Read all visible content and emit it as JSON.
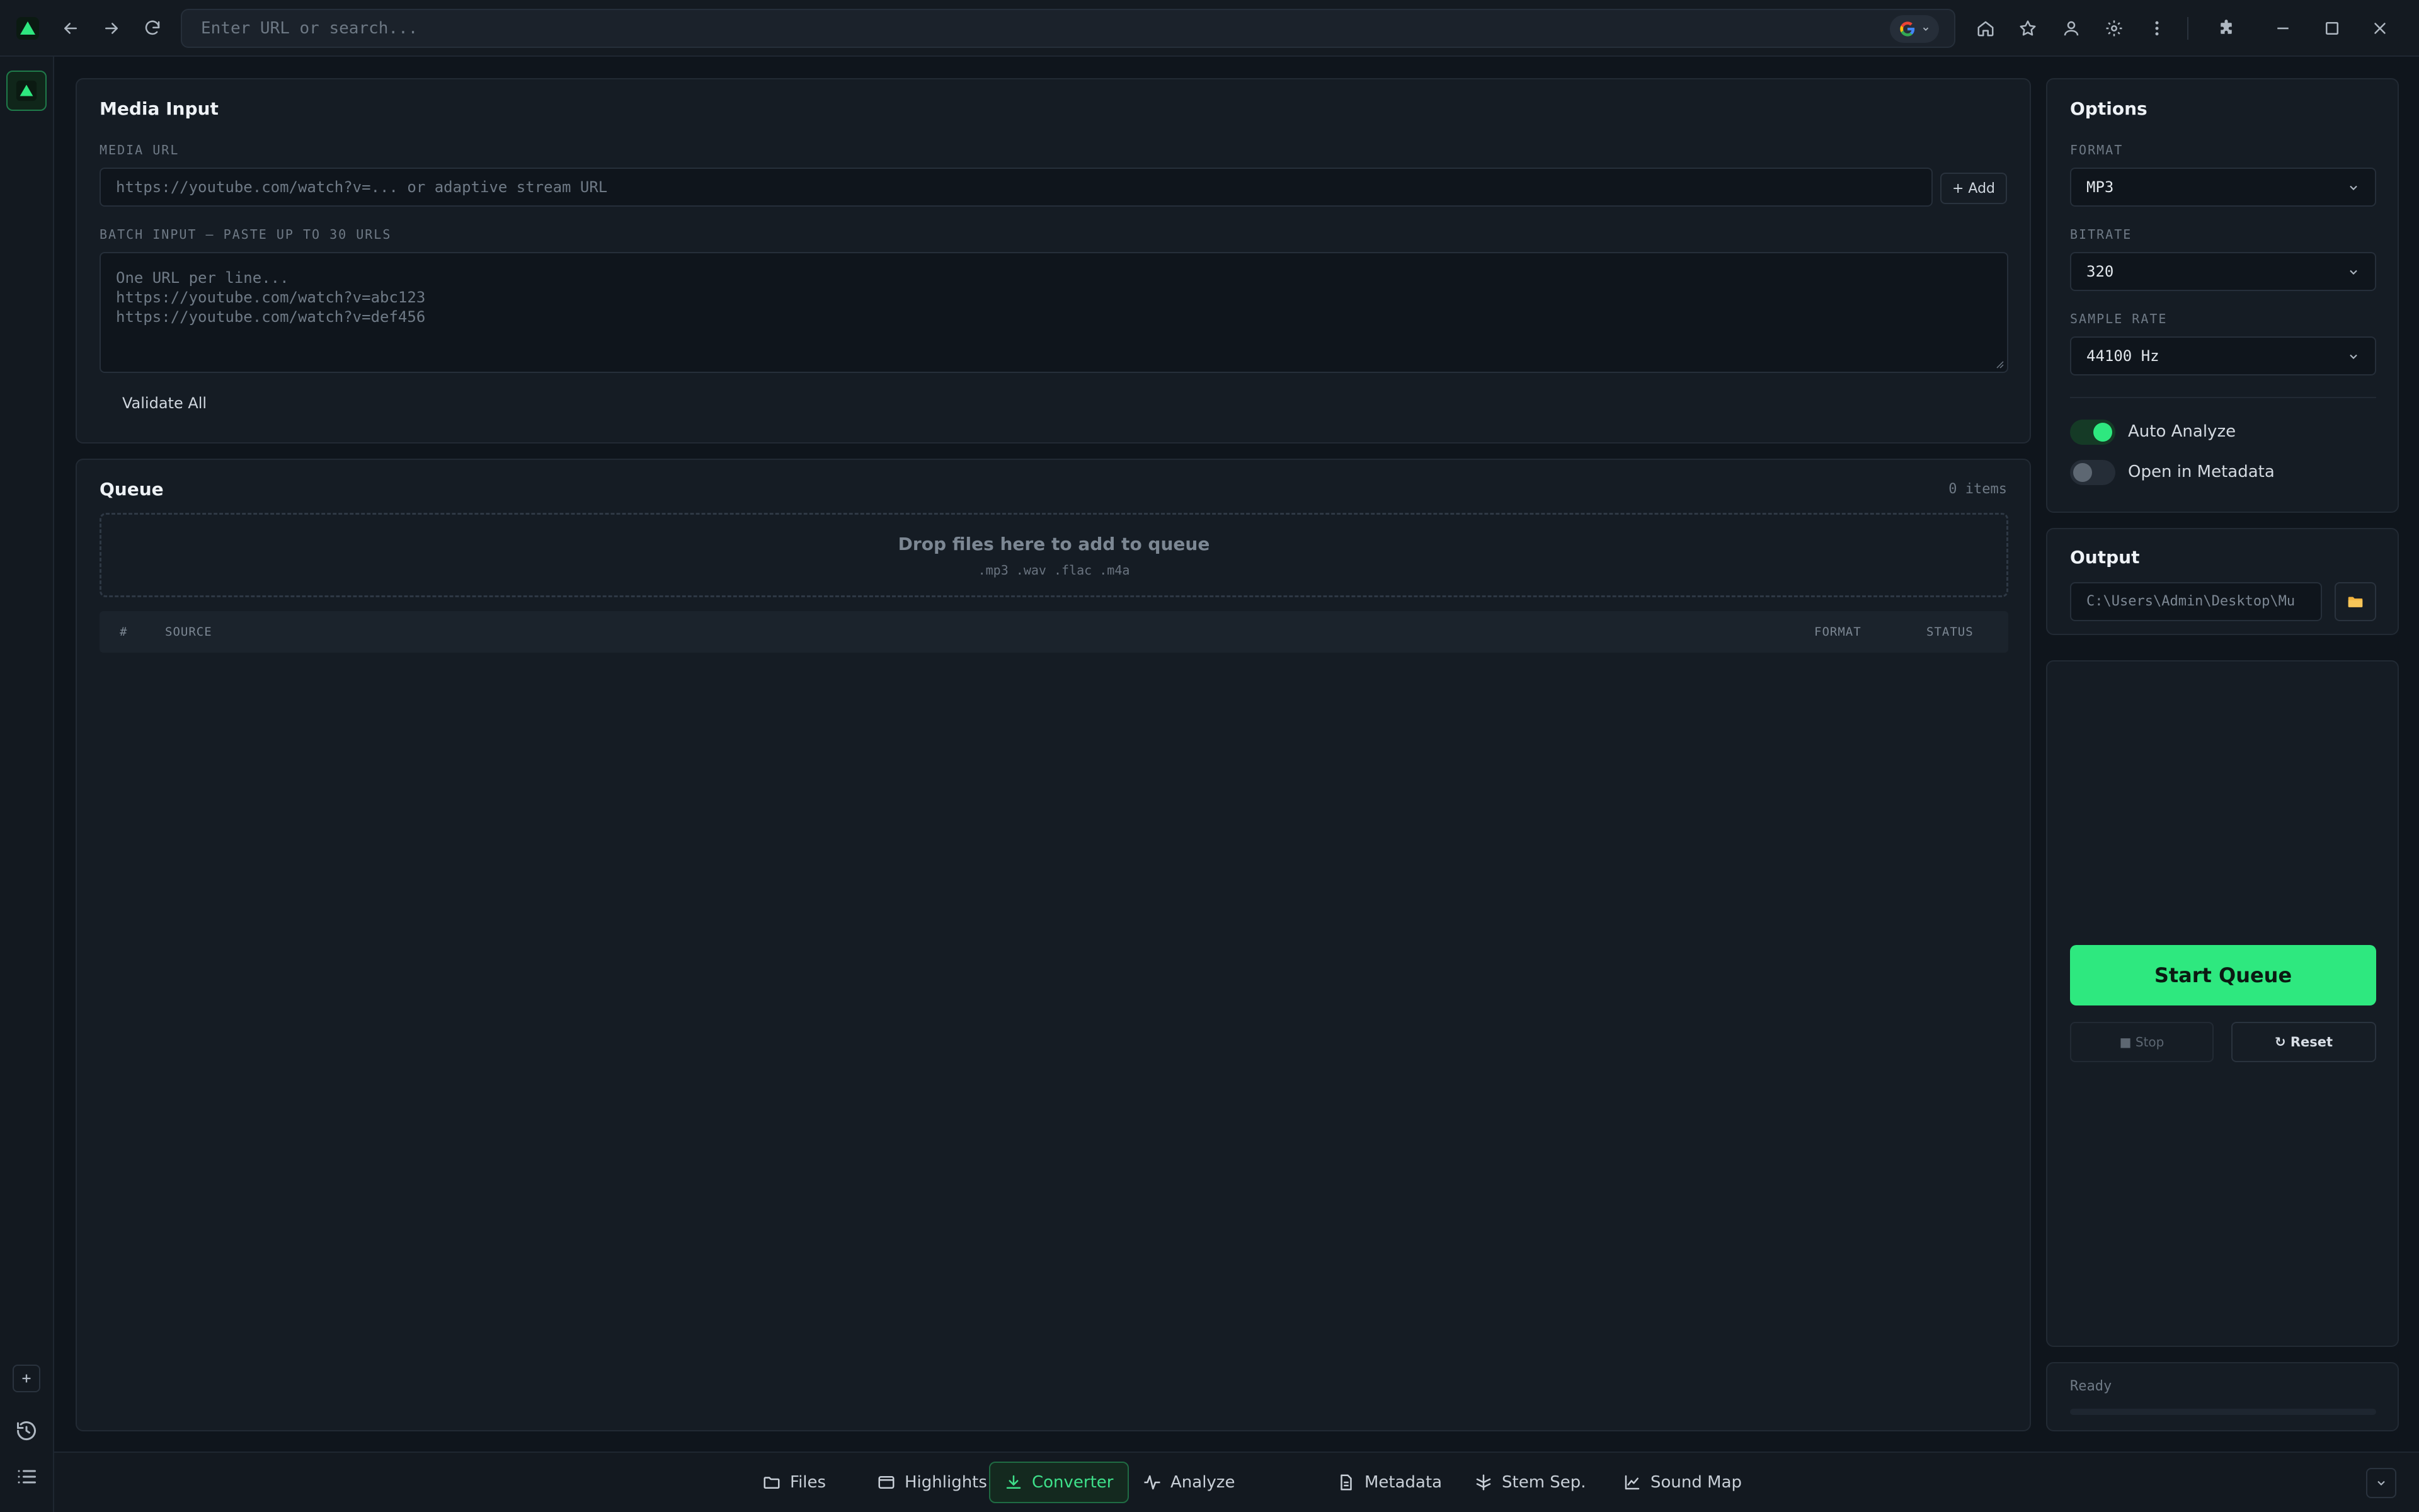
{
  "browser": {
    "url_placeholder": "Enter URL or search...",
    "accent": "#2ee87f"
  },
  "media_input": {
    "title": "Media Input",
    "media_url_label": "MEDIA URL",
    "media_url_placeholder": "https://youtube.com/watch?v=... or adaptive stream URL",
    "add_label": "+ Add",
    "batch_label": "BATCH INPUT — PASTE UP TO 30 URLS",
    "batch_placeholder": "One URL per line...\nhttps://youtube.com/watch?v=abc123\nhttps://youtube.com/watch?v=def456",
    "validate_label": "Validate All"
  },
  "queue": {
    "title": "Queue",
    "count": "0 items",
    "drop_title": "Drop files here to add to queue",
    "drop_formats": ".mp3 .wav .flac .m4a",
    "columns": {
      "index": "#",
      "source": "SOURCE",
      "format": "FORMAT",
      "status": "STATUS"
    },
    "rows": []
  },
  "options": {
    "title": "Options",
    "format_label": "FORMAT",
    "format_value": "MP3",
    "bitrate_label": "BITRATE",
    "bitrate_value": "320",
    "sample_rate_label": "SAMPLE RATE",
    "sample_rate_value": "44100 Hz",
    "auto_analyze_label": "Auto Analyze",
    "auto_analyze_on": true,
    "open_metadata_label": "Open in Metadata",
    "open_metadata_on": false
  },
  "output": {
    "title": "Output",
    "path": "C:\\Users\\Admin\\Desktop\\Mu"
  },
  "actions": {
    "start_label": "Start Queue",
    "stop_label": "■ Stop",
    "reset_label": "↻ Reset"
  },
  "status": {
    "text": "Ready",
    "progress": 0
  },
  "nav": {
    "tabs": [
      {
        "label": "Files",
        "icon": "folder-icon"
      },
      {
        "label": "Highlights",
        "icon": "highlights-icon"
      },
      {
        "label": "Converter",
        "icon": "download-icon",
        "active": true
      },
      {
        "label": "Analyze",
        "icon": "waveform-icon"
      },
      {
        "label": "Metadata",
        "icon": "document-icon"
      },
      {
        "label": "Stem Sep.",
        "icon": "split-icon"
      },
      {
        "label": "Sound Map",
        "icon": "chart-icon"
      }
    ]
  }
}
